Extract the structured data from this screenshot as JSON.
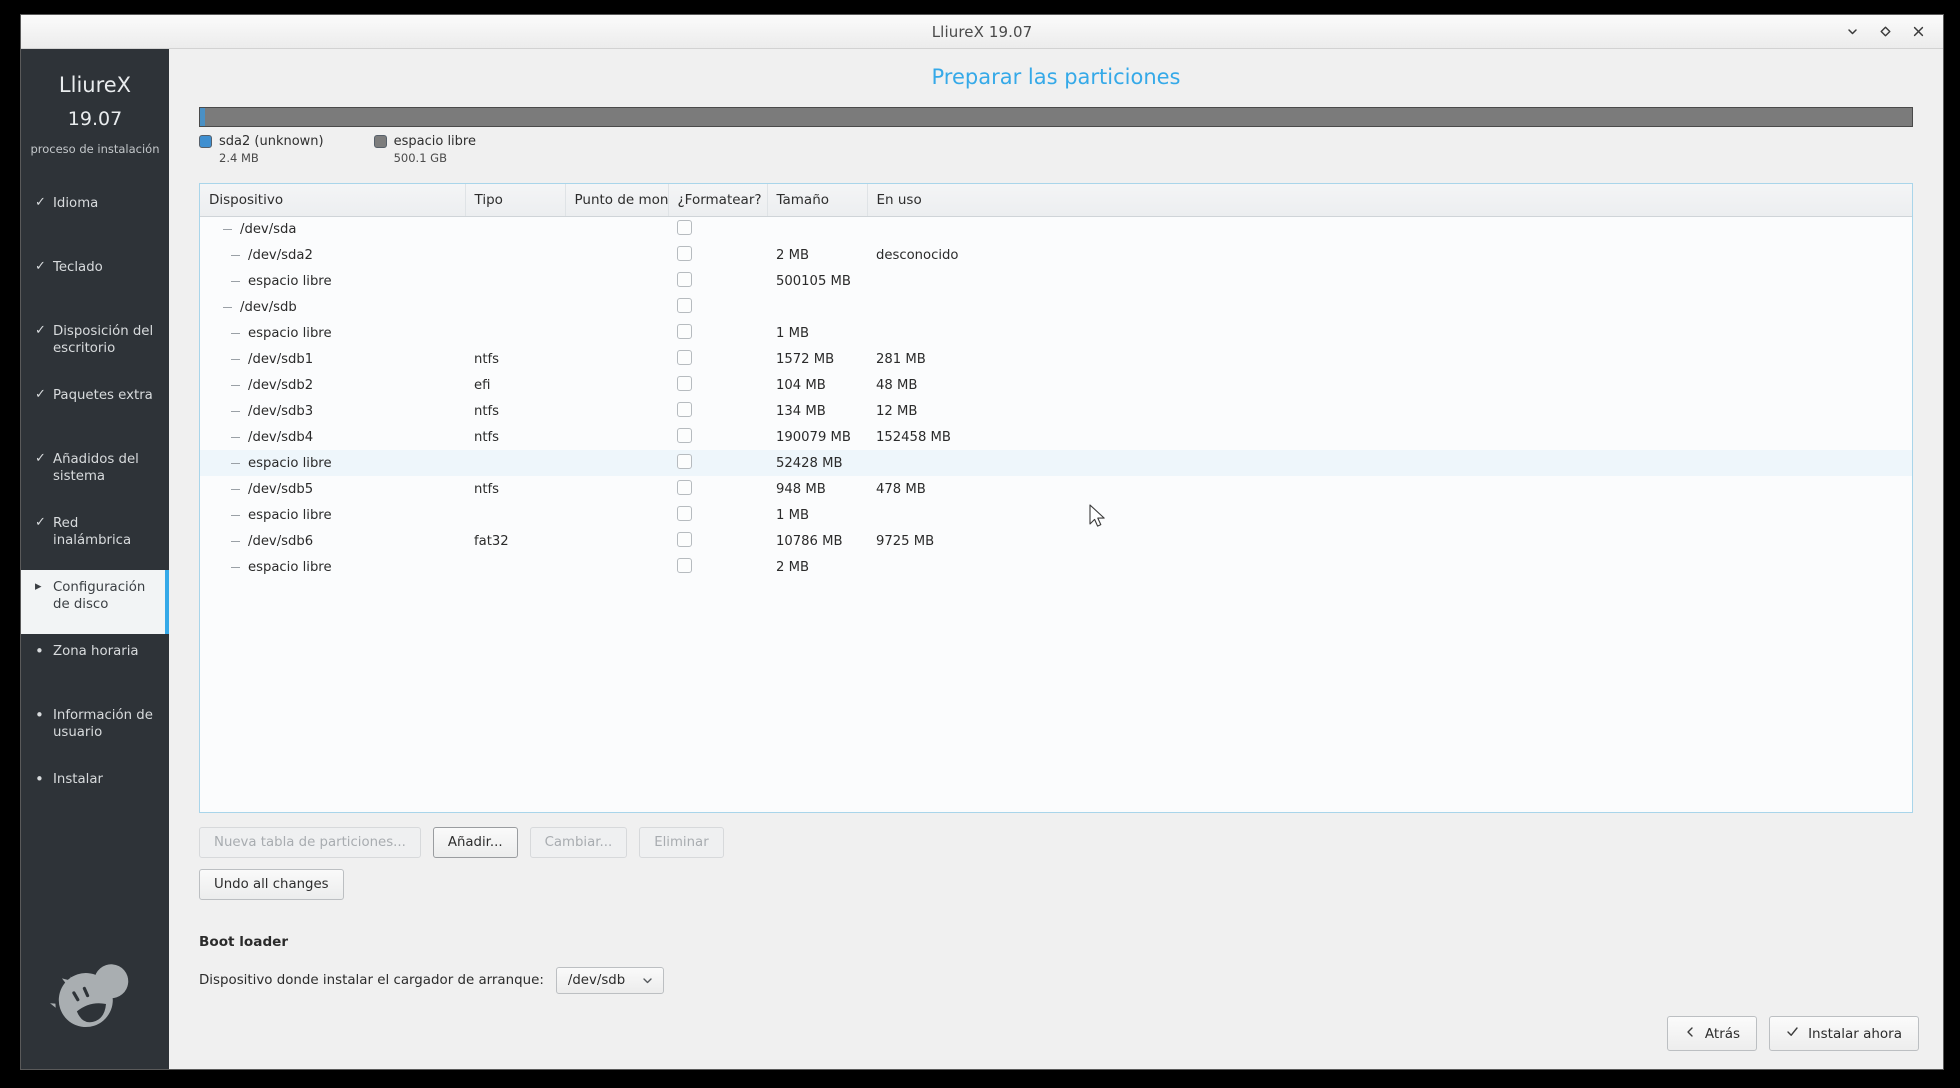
{
  "window": {
    "title": "LliureX 19.07",
    "controls": [
      {
        "name": "minimize-button",
        "glyph": "chevron-down"
      },
      {
        "name": "maximize-button",
        "glyph": "diamond"
      },
      {
        "name": "close-button",
        "glyph": "x"
      }
    ]
  },
  "sidebar": {
    "brand_name": "LliureX",
    "brand_version": "19.07",
    "brand_subtitle": "proceso de instalación",
    "items": [
      {
        "label": "Idioma",
        "mark": "✓",
        "state": "done"
      },
      {
        "label": "Teclado",
        "mark": "✓",
        "state": "done"
      },
      {
        "label": "Disposición del escritorio",
        "mark": "✓",
        "state": "done"
      },
      {
        "label": "Paquetes extra",
        "mark": "✓",
        "state": "done"
      },
      {
        "label": "Añadidos del sistema",
        "mark": "✓",
        "state": "done"
      },
      {
        "label": "Red inalámbrica",
        "mark": "✓",
        "state": "done"
      },
      {
        "label": "Configuración de disco",
        "mark": "▸",
        "state": "active"
      },
      {
        "label": "Zona horaria",
        "mark": "•",
        "state": "pending"
      },
      {
        "label": "Información de usuario",
        "mark": "•",
        "state": "pending"
      },
      {
        "label": "Instalar",
        "mark": "•",
        "state": "pending"
      }
    ]
  },
  "page": {
    "title": "Preparar las particiones"
  },
  "partition_bar": {
    "segments": [
      {
        "name": "sda2",
        "color": "#4a90c4",
        "percent": 0.3
      },
      {
        "name": "espacio libre",
        "color": "#7b7b7b",
        "percent": 99.7
      }
    ],
    "legend": [
      {
        "label": "sda2 (unknown)",
        "size": "2.4 MB",
        "color": "#3f8fd0"
      },
      {
        "label": "espacio libre",
        "size": "500.1 GB",
        "color": "#7d7d7d"
      }
    ]
  },
  "table": {
    "columns": [
      "Dispositivo",
      "Tipo",
      "Punto de mon",
      "¿Formatear?",
      "Tamaño",
      "En uso"
    ],
    "rows": [
      {
        "device": "/dev/sda",
        "indent": 1,
        "type": "",
        "mount": "",
        "format": false,
        "size": "",
        "used": "",
        "selected": false
      },
      {
        "device": "/dev/sda2",
        "indent": 2,
        "type": "",
        "mount": "",
        "format": false,
        "size": "2 MB",
        "used": "desconocido",
        "selected": false
      },
      {
        "device": "espacio libre",
        "indent": 2,
        "type": "",
        "mount": "",
        "format": false,
        "size": "500105 MB",
        "used": "",
        "selected": false
      },
      {
        "device": "/dev/sdb",
        "indent": 1,
        "type": "",
        "mount": "",
        "format": false,
        "size": "",
        "used": "",
        "selected": false
      },
      {
        "device": "espacio libre",
        "indent": 2,
        "type": "",
        "mount": "",
        "format": false,
        "size": "1 MB",
        "used": "",
        "selected": false
      },
      {
        "device": "/dev/sdb1",
        "indent": 2,
        "type": "ntfs",
        "mount": "",
        "format": false,
        "size": "1572 MB",
        "used": "281 MB",
        "selected": false
      },
      {
        "device": "/dev/sdb2",
        "indent": 2,
        "type": "efi",
        "mount": "",
        "format": false,
        "size": "104 MB",
        "used": "48 MB",
        "selected": false
      },
      {
        "device": "/dev/sdb3",
        "indent": 2,
        "type": "ntfs",
        "mount": "",
        "format": false,
        "size": "134 MB",
        "used": "12 MB",
        "selected": false
      },
      {
        "device": "/dev/sdb4",
        "indent": 2,
        "type": "ntfs",
        "mount": "",
        "format": false,
        "size": "190079 MB",
        "used": "152458 MB",
        "selected": false
      },
      {
        "device": "espacio libre",
        "indent": 2,
        "type": "",
        "mount": "",
        "format": false,
        "size": "52428 MB",
        "used": "",
        "selected": true
      },
      {
        "device": "/dev/sdb5",
        "indent": 2,
        "type": "ntfs",
        "mount": "",
        "format": false,
        "size": "948 MB",
        "used": "478 MB",
        "selected": false
      },
      {
        "device": "espacio libre",
        "indent": 2,
        "type": "",
        "mount": "",
        "format": false,
        "size": "1 MB",
        "used": "",
        "selected": false
      },
      {
        "device": "/dev/sdb6",
        "indent": 2,
        "type": "fat32",
        "mount": "",
        "format": false,
        "size": "10786 MB",
        "used": "9725 MB",
        "selected": false
      },
      {
        "device": "espacio libre",
        "indent": 2,
        "type": "",
        "mount": "",
        "format": false,
        "size": "2 MB",
        "used": "",
        "selected": false
      }
    ]
  },
  "actions": {
    "new_table": "Nueva tabla de particiones...",
    "add": "Añadir...",
    "change": "Cambiar...",
    "delete": "Eliminar",
    "undo": "Undo all changes"
  },
  "bootloader": {
    "heading": "Boot loader",
    "label": "Dispositivo donde instalar el cargador de arranque:",
    "selected": "/dev/sdb"
  },
  "footer": {
    "back": "Atrás",
    "install": "Instalar ahora"
  }
}
